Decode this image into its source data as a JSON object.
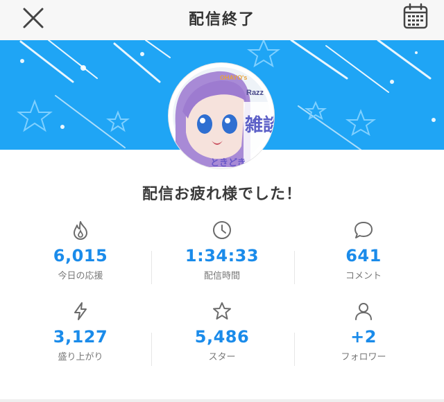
{
  "header": {
    "title": "配信終了",
    "close_icon": "close-icon",
    "calendar_icon": "calendar-icon"
  },
  "colors": {
    "banner": "#1fa5f5",
    "accent_value": "#1a8bea",
    "icon": "#6b6b6b"
  },
  "avatar": {
    "overlay_text": [
      "OHAYO's",
      "Razz",
      "雑談",
      "ときどき"
    ]
  },
  "message": "配信お疲れ様でした！",
  "stats": [
    {
      "icon": "flame-icon",
      "value": "6,015",
      "label": "今日の応援"
    },
    {
      "icon": "clock-icon",
      "value": "1:34:33",
      "label": "配信時間"
    },
    {
      "icon": "comment-bubble-icon",
      "value": "641",
      "label": "コメント"
    },
    {
      "icon": "lightning-icon",
      "value": "3,127",
      "label": "盛り上がり"
    },
    {
      "icon": "star-icon",
      "value": "5,486",
      "label": "スター"
    },
    {
      "icon": "person-icon",
      "value": "+2",
      "label": "フォロワー"
    }
  ]
}
